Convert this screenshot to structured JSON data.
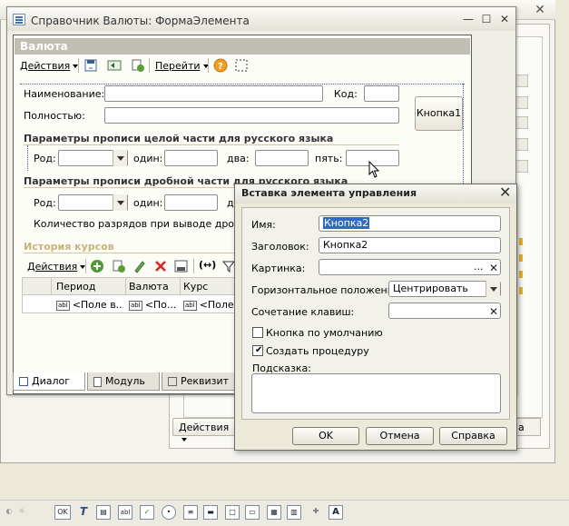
{
  "background": {
    "title": "Справочник Валюты: ФормаЭлемента",
    "actions_label": "Действия",
    "right_button_label": "а"
  },
  "main_window": {
    "title": "Справочник Валюты: ФормаЭлемента",
    "form_header": "Валюта",
    "toolbar": {
      "actions": "Действия",
      "goto": "Перейти"
    },
    "fields": {
      "name_label": "Наименование:",
      "code_label": "Код:",
      "fullname_label": "Полностью:",
      "button1_label": "Кнопка1"
    },
    "section_int": {
      "title": "Параметры прописи целой части для русского языка",
      "gender_label": "Род:",
      "one_label": "один:",
      "two_label": "два:",
      "five_label": "пять:"
    },
    "section_frac": {
      "title": "Параметры прописи дробной части для русского языка",
      "gender_label": "Род:",
      "one_label": "один:",
      "two_label": "д",
      "digits_label": "Количество разрядов при выводе дробной"
    },
    "history": {
      "title": "История курсов",
      "actions": "Действия",
      "columns": [
        "Период",
        "Валюта",
        "Курс"
      ],
      "row": [
        "<Поле в...",
        "<По...",
        "<Поле"
      ]
    },
    "tabs": [
      "Диалог",
      "Модуль",
      "Реквизит"
    ]
  },
  "dialog": {
    "title": "Вставка элемента управления",
    "name_label": "Имя:",
    "name_value": "Кнопка2",
    "caption_label": "Заголовок:",
    "caption_value": "Кнопка2",
    "picture_label": "Картинка:",
    "picture_value": "",
    "picture_button": "...",
    "halign_label": "Горизонтальное положение:",
    "halign_value": "Центрировать",
    "shortcut_label": "Сочетание клавиш:",
    "shortcut_value": "",
    "default_button_label": "Кнопка по умолчанию",
    "default_button_checked": false,
    "create_proc_label": "Создать процедуру",
    "create_proc_checked": true,
    "hint_label": "Подсказка:",
    "hint_value": "",
    "ok": "OK",
    "cancel": "Отмена",
    "help": "Справка"
  },
  "bottom_toolbar": {
    "ok_icon_text": "OK",
    "text_icon": "T",
    "abl_icon_text": "abl",
    "a_icon_text": "A"
  }
}
